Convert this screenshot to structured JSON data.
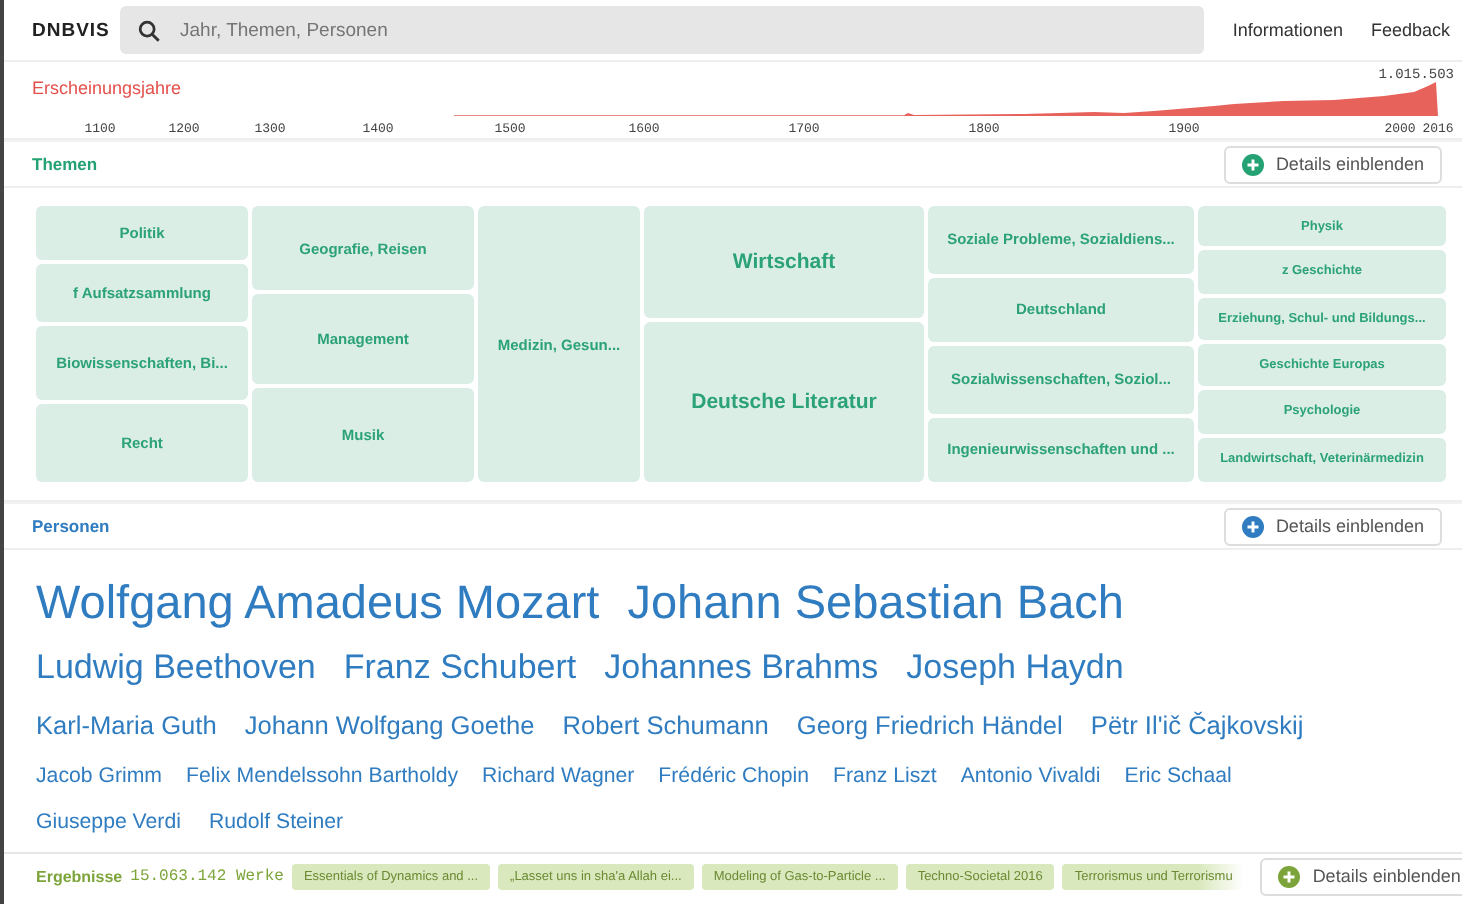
{
  "header": {
    "logo": "DNBVIS",
    "search": {
      "placeholder": "Jahr, Themen, Personen"
    },
    "links": [
      "Informationen",
      "Feedback"
    ]
  },
  "years": {
    "title": "Erscheinungsjahre",
    "max_label": "1.015.503",
    "ticks": [
      "1100",
      "1200",
      "1300",
      "1400",
      "1500",
      "1600",
      "1700",
      "1800",
      "1900",
      "2000",
      "2016"
    ]
  },
  "themes": {
    "title": "Themen",
    "kind": "themes",
    "button": "Details einblenden",
    "columns": [
      {
        "items": [
          "Politik",
          "f Aufsatzsammlung",
          "Biowissenschaften, Bi...",
          "Recht"
        ]
      },
      {
        "items": [
          "Geografie, Reisen",
          "Management",
          "Musik"
        ]
      },
      {
        "items": [
          "Medizin, Gesun..."
        ]
      },
      {
        "items": [
          "Wirtschaft",
          "Deutsche Literatur"
        ]
      },
      {
        "items": [
          "Soziale Probleme, Sozialdiens...",
          "Deutschland",
          "Sozialwissenschaften, Soziol...",
          "Ingenieurwissenschaften und ..."
        ]
      },
      {
        "items": [
          "Physik",
          "z Geschichte",
          "Erziehung, Schul- und Bildungs...",
          "Geschichte Europas",
          "Psychologie",
          "Landwirtschaft, Veterinärmedizin"
        ]
      }
    ]
  },
  "persons": {
    "title": "Personen",
    "kind": "persons",
    "button": "Details einblenden",
    "names": [
      "Wolfgang Amadeus Mozart",
      "Johann Sebastian Bach",
      "Ludwig Beethoven",
      "Franz Schubert",
      "Johannes Brahms",
      "Joseph Haydn",
      "Karl-Maria Guth",
      "Johann Wolfgang Goethe",
      "Robert Schumann",
      "Georg Friedrich Händel",
      "Pëtr Il'ič Čajkovskij",
      "Jacob Grimm",
      "Felix Mendelssohn Bartholdy",
      "Richard Wagner",
      "Frédéric Chopin",
      "Franz Liszt",
      "Antonio Vivaldi",
      "Eric Schaal",
      "Giuseppe Verdi",
      "Rudolf Steiner"
    ]
  },
  "results": {
    "title": "Ergebnisse",
    "kind": "results",
    "count": "15.063.142 Werke",
    "items": [
      "Essentials of Dynamics and ...",
      "„Lasset uns in sha'a Allah ei...",
      "Modeling of Gas-to-Particle ...",
      "Techno-Societal 2016",
      "Terrorismus und Terrorismu"
    ],
    "button": "Details einblenden"
  }
}
